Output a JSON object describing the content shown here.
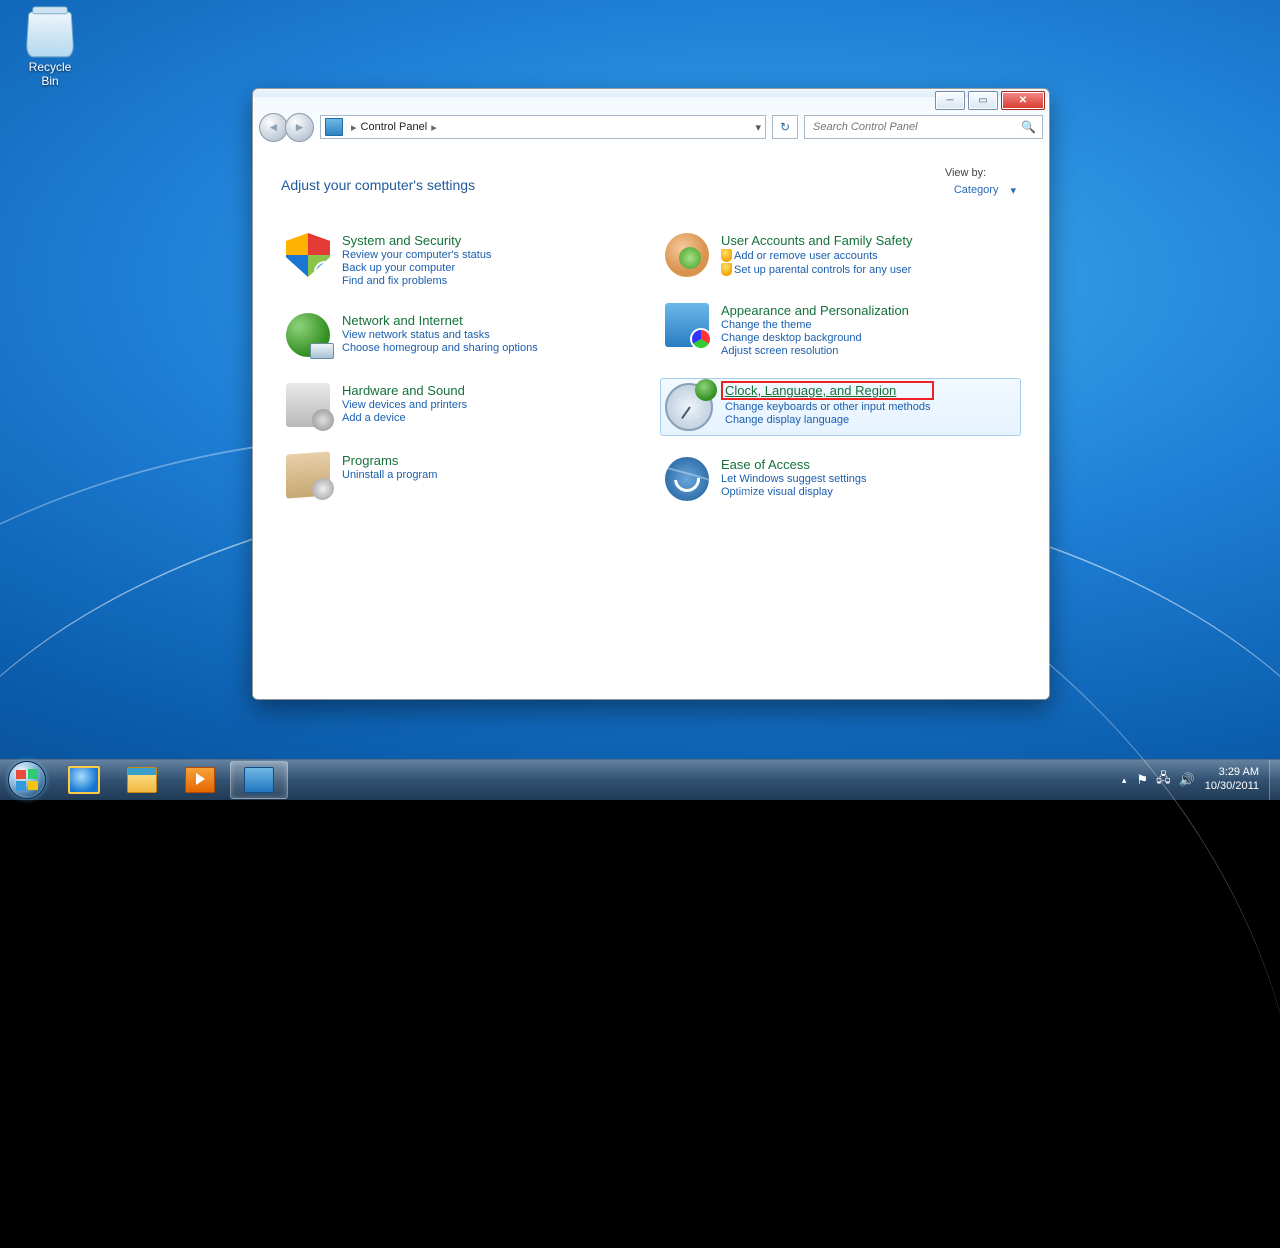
{
  "desktop": {
    "recycle_bin": "Recycle Bin"
  },
  "window": {
    "controls": {
      "min": "─",
      "max": "▭",
      "close": "✕"
    },
    "nav": {
      "back": "◄",
      "forward": "►",
      "breadcrumb_root_icon": "⊞",
      "breadcrumb": "Control Panel",
      "crumb_sep": "▸",
      "dropdown": "▾",
      "refresh": "↻"
    },
    "search": {
      "placeholder": "Search Control Panel"
    },
    "heading": "Adjust your computer's settings",
    "viewby_label": "View by:",
    "viewby_value": "Category",
    "left": [
      {
        "title": "System and Security",
        "links": [
          "Review your computer's status",
          "Back up your computer",
          "Find and fix problems"
        ]
      },
      {
        "title": "Network and Internet",
        "links": [
          "View network status and tasks",
          "Choose homegroup and sharing options"
        ]
      },
      {
        "title": "Hardware and Sound",
        "links": [
          "View devices and printers",
          "Add a device"
        ]
      },
      {
        "title": "Programs",
        "links": [
          "Uninstall a program"
        ]
      }
    ],
    "right": [
      {
        "title": "User Accounts and Family Safety",
        "links": [
          "Add or remove user accounts",
          "Set up parental controls for any user"
        ],
        "shield": true
      },
      {
        "title": "Appearance and Personalization",
        "links": [
          "Change the theme",
          "Change desktop background",
          "Adjust screen resolution"
        ]
      },
      {
        "title": "Clock, Language, and Region",
        "links": [
          "Change keyboards or other input methods",
          "Change display language"
        ],
        "hover": true,
        "highlight": true
      },
      {
        "title": "Ease of Access",
        "links": [
          "Let Windows suggest settings",
          "Optimize visual display"
        ]
      }
    ]
  },
  "taskbar": {
    "tray_up": "▴",
    "time": "3:29 AM",
    "date": "10/30/2011"
  }
}
